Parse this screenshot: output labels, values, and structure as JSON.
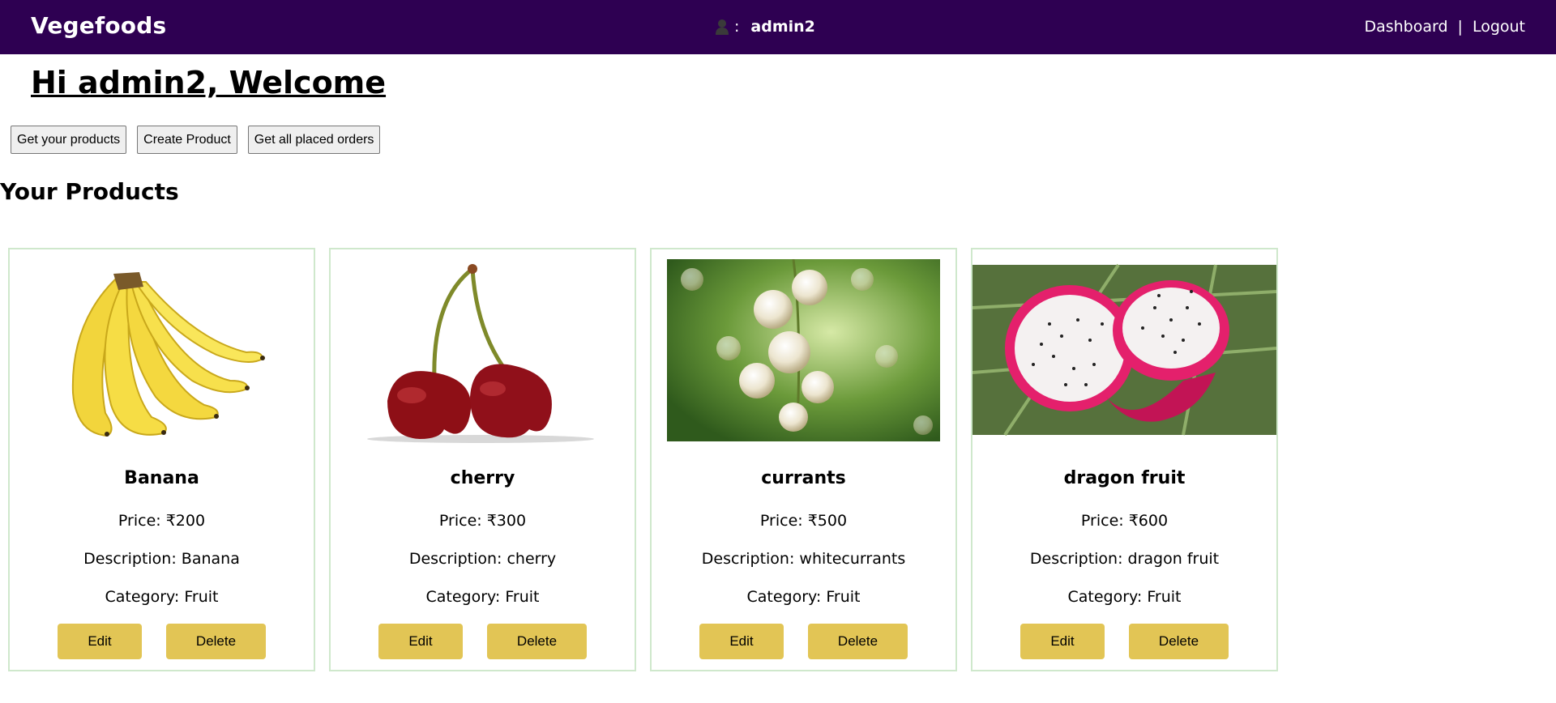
{
  "navbar": {
    "brand": "Vegefoods",
    "user_separator": ":",
    "username": "admin2",
    "links": {
      "dashboard": "Dashboard",
      "separator": "|",
      "logout": "Logout"
    },
    "background": "#2e0052"
  },
  "welcome": "Hi admin2, Welcome",
  "actions": {
    "get_products": "Get your products",
    "create_product": "Create Product",
    "get_orders": "Get all placed orders"
  },
  "section_title": "Your Products",
  "products": [
    {
      "name": "Banana",
      "price": "Price: ₹200",
      "description": "Description: Banana",
      "category": "Category: Fruit",
      "edit": "Edit",
      "delete": "Delete"
    },
    {
      "name": "cherry",
      "price": "Price: ₹300",
      "description": "Description: cherry",
      "category": "Category: Fruit",
      "edit": "Edit",
      "delete": "Delete"
    },
    {
      "name": "currants",
      "price": "Price: ₹500",
      "description": "Description: whitecurrants",
      "category": "Category: Fruit",
      "edit": "Edit",
      "delete": "Delete"
    },
    {
      "name": "dragon fruit",
      "price": "Price: ₹600",
      "description": "Description: dragon fruit",
      "category": "Category: Fruit",
      "edit": "Edit",
      "delete": "Delete"
    }
  ],
  "colors": {
    "button_accent": "#e2c555",
    "card_border": "#cfe8cc"
  }
}
